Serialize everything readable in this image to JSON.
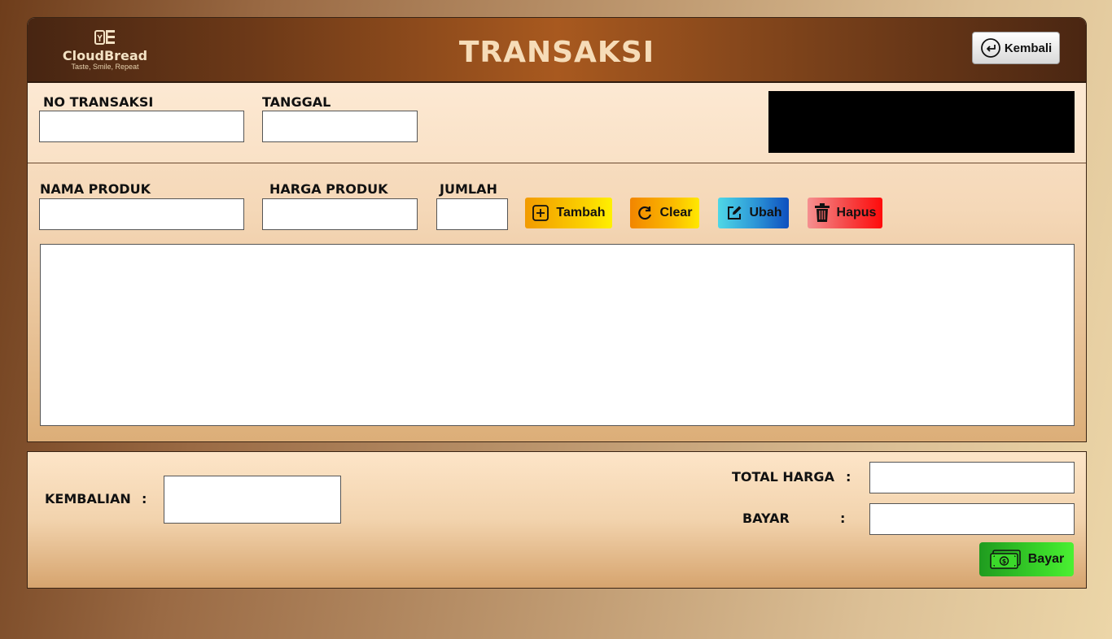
{
  "app": {
    "logo_name": "CloudBread",
    "logo_tagline": "Taste, Smile, Repeat",
    "title": "TRANSAKSI",
    "back_label": "Kembali"
  },
  "transaction": {
    "no_label": "NO TRANSAKSI",
    "no_value": "",
    "date_label": "TANGGAL",
    "date_value": ""
  },
  "product": {
    "name_label": "NAMA PRODUK",
    "name_value": "",
    "price_label": "HARGA PRODUK",
    "price_value": "",
    "qty_label": "JUMLAH",
    "qty_value": ""
  },
  "actions": {
    "add_label": "Tambah",
    "clear_label": "Clear",
    "edit_label": "Ubah",
    "delete_label": "Hapus"
  },
  "payment": {
    "change_label": "KEMBALIAN",
    "change_value": "",
    "total_label": "TOTAL HARGA",
    "total_value": "",
    "pay_label": "BAYAR",
    "pay_value": "",
    "colon": ":",
    "pay_button_label": "Bayar"
  },
  "colors": {
    "add_button": "#f7b500",
    "clear_button": "#f79a00",
    "edit_button": "#1a6fd1",
    "delete_button": "#f24242",
    "pay_button": "#34c62a"
  }
}
